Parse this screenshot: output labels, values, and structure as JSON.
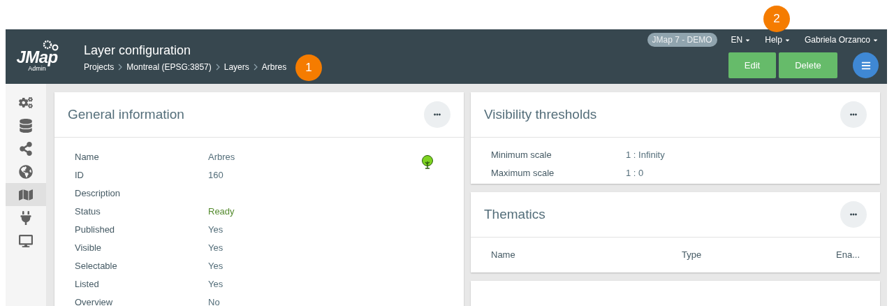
{
  "logo": {
    "wordmark": "JMap",
    "subtitle": "Admin"
  },
  "header": {
    "title": "Layer configuration",
    "breadcrumb": [
      "Projects",
      "Montreal (EPSG:3857)",
      "Layers",
      "Arbres"
    ],
    "env_badge": "JMap 7 - DEMO",
    "menus": [
      "EN",
      "Help",
      "Gabriela Orzanco"
    ],
    "buttons": [
      "Edit",
      "Delete"
    ]
  },
  "callouts": [
    "1",
    "2"
  ],
  "sidebar": {
    "items": [
      {
        "kind": "gears",
        "selected": false
      },
      {
        "kind": "database",
        "selected": false
      },
      {
        "kind": "share",
        "selected": false
      },
      {
        "kind": "globe",
        "selected": false
      },
      {
        "kind": "map",
        "selected": true
      },
      {
        "kind": "plug",
        "selected": false
      },
      {
        "kind": "monitor",
        "selected": false
      }
    ]
  },
  "general_information": {
    "title": "General information",
    "fields": [
      {
        "label": "Name",
        "value": "Arbres"
      },
      {
        "label": "ID",
        "value": "160"
      },
      {
        "label": "Description"
      },
      {
        "label": "Status",
        "value": "Ready",
        "kind": "status"
      },
      {
        "label": "Published",
        "value": "Yes"
      },
      {
        "label": "Visible",
        "value": "Yes"
      },
      {
        "label": "Selectable",
        "value": "Yes"
      },
      {
        "label": "Listed",
        "value": "Yes"
      },
      {
        "label": "Overview",
        "value": "No"
      }
    ]
  },
  "visibility_thresholds": {
    "title": "Visibility thresholds",
    "fields": [
      {
        "label": "Minimum scale",
        "value": "1 : Infinity"
      },
      {
        "label": "Maximum scale",
        "value": "1 : 0"
      }
    ]
  },
  "thematics": {
    "title": "Thematics",
    "columns": [
      "Name",
      "Type",
      "Ena..."
    ]
  }
}
